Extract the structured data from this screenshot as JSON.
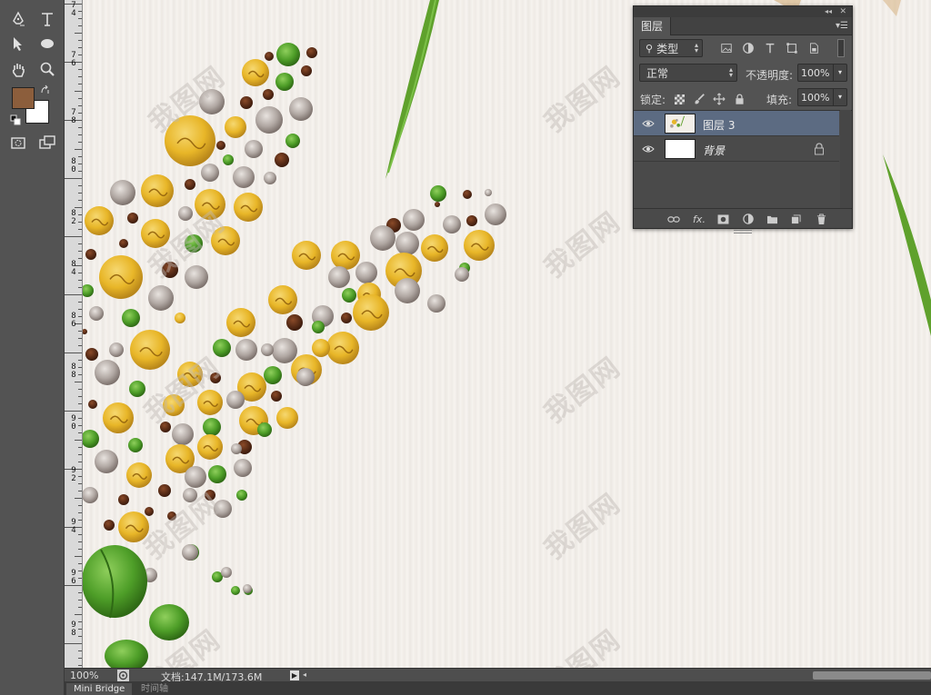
{
  "layers_panel": {
    "title": "图层",
    "filter_label": "类型",
    "blend_mode": "正常",
    "opacity_label": "不透明度:",
    "opacity_value": "100%",
    "lock_label": "锁定:",
    "fill_label": "填充:",
    "fill_value": "100%",
    "layers": [
      {
        "name": "图层 3",
        "selected": true
      },
      {
        "name": "背景",
        "selected": false,
        "locked": true
      }
    ],
    "footer_fx": "fx"
  },
  "status_bar": {
    "zoom": "100%",
    "doc_info": "文档:147.1M/173.6M"
  },
  "bottom_tabs": [
    "Mini Bridge",
    "时间轴"
  ],
  "ruler": {
    "labels": [
      "7\n4",
      "7\n6",
      "7\n8",
      "8\n0",
      "8\n2",
      "8\n4",
      "8\n6",
      "8\n8",
      "9\n0",
      "9\n2",
      "9\n4",
      "9\n6",
      "9\n8"
    ]
  },
  "watermark": "我图网",
  "colors": {
    "foreground": "#8c5e3c",
    "background": "#ffffff",
    "selection": "#5c6b82",
    "panel": "#535353"
  },
  "icons": {
    "toolbox": [
      "pen-icon",
      "type-icon",
      "path-select-icon",
      "ellipse-icon",
      "hand-icon",
      "zoom-icon",
      "quick-mask-icon",
      "screen-mode-icon"
    ]
  }
}
